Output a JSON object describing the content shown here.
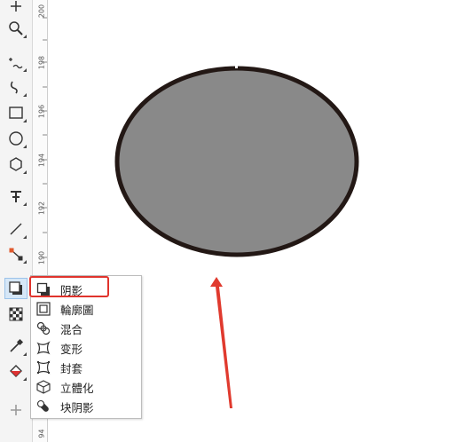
{
  "ruler": {
    "labels": [
      "200",
      "198",
      "196",
      "194",
      "192",
      "190",
      "94"
    ]
  },
  "flyout": {
    "items": [
      {
        "label": "阴影"
      },
      {
        "label": "輪廓圖"
      },
      {
        "label": "混合"
      },
      {
        "label": "变形"
      },
      {
        "label": "封套"
      },
      {
        "label": "立體化"
      },
      {
        "label": "块阴影"
      }
    ]
  },
  "colors": {
    "ellipse_fill": "#898989",
    "ellipse_stroke": "#231815",
    "arrow": "#e03a2e",
    "highlight": "#e0332c"
  }
}
